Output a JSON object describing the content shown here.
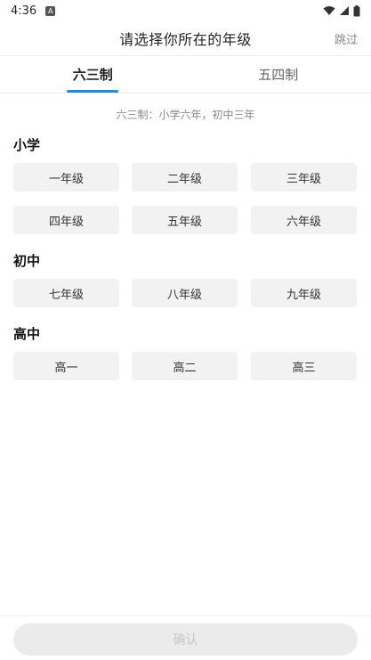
{
  "status_bar": {
    "time": "4:36",
    "notification_glyph": "A",
    "icons": [
      "wifi-icon",
      "signal-icon",
      "battery-icon"
    ]
  },
  "header": {
    "title": "请选择你所在的年级",
    "skip_label": "跳过"
  },
  "tabs": [
    {
      "label": "六三制",
      "active": true
    },
    {
      "label": "五四制",
      "active": false
    }
  ],
  "subtitle": "六三制：小学六年，初中三年",
  "sections": {
    "primary": {
      "title": "小学",
      "grades": [
        "一年级",
        "二年级",
        "三年级",
        "四年级",
        "五年级",
        "六年级"
      ]
    },
    "junior": {
      "title": "初中",
      "grades": [
        "七年级",
        "八年级",
        "九年级"
      ]
    },
    "senior": {
      "title": "高中",
      "grades": [
        "高一",
        "高二",
        "高三"
      ]
    }
  },
  "footer": {
    "confirm_label": "确认"
  },
  "colors": {
    "accent": "#1a8fe0",
    "button_bg": "#f2f2f2",
    "confirm_disabled_bg": "#ebebeb"
  }
}
